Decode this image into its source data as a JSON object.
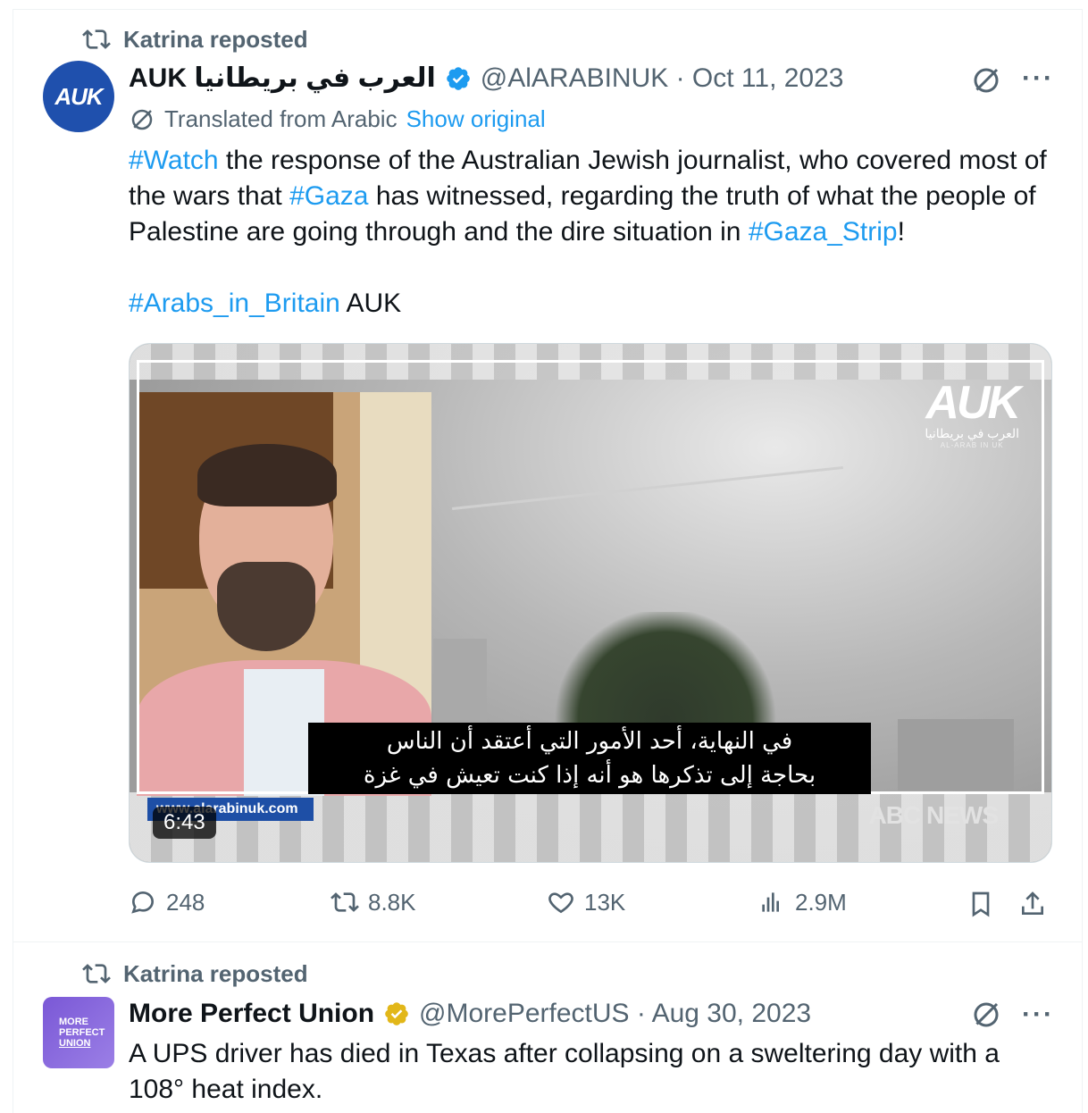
{
  "tweet1": {
    "reposted_by": "Katrina reposted",
    "name": "AUK العرب في بريطانيا",
    "handle_date": "@AlARABINUK · Oct 11, 2023",
    "avatar_text": "AUK",
    "translated_label": "Translated from Arabic",
    "show_original": "Show original",
    "text_segments": [
      {
        "t": "#Watch",
        "tag": true
      },
      {
        "t": " the response of the Australian Jewish journalist, who covered most of the wars that ",
        "tag": false
      },
      {
        "t": "#Gaza",
        "tag": true
      },
      {
        "t": " has witnessed, regarding the truth of what the people of Palestine are going through and the dire situation in ",
        "tag": false
      },
      {
        "t": "#Gaza_Strip",
        "tag": true
      },
      {
        "t": "!",
        "tag": false
      }
    ],
    "second_para_tag": "#Arabs_in_Britain",
    "second_para_text": " AUK",
    "media": {
      "logo": "AUK",
      "logo_ar": "العرب في بريطانيا",
      "logo_en": "AL-ARAB IN UK",
      "subtitle_line1": "في النهاية، أحد الأمور التي أعتقد أن الناس",
      "subtitle_line2": "بحاجة إلى تذكرها هو أنه إذا كنت تعيش في غزة",
      "site": "www.alarabinuk.com",
      "news_mark": "ABC NEWS",
      "duration": "6:43"
    },
    "actions": {
      "replies": "248",
      "reposts": "8.8K",
      "likes": "13K",
      "views": "2.9M"
    }
  },
  "tweet2": {
    "reposted_by": "Katrina reposted",
    "name": "More Perfect Union",
    "handle_date": "@MorePerfectUS · Aug 30, 2023",
    "avatar_lines": [
      "MORE",
      "PERFECT",
      "UNION"
    ],
    "text": "A UPS driver has died in Texas after collapsing on a sweltering day with a 108° heat index."
  },
  "colors": {
    "accent": "#1d9bf0",
    "muted": "#536471",
    "gold_verified": "#e2b719"
  }
}
